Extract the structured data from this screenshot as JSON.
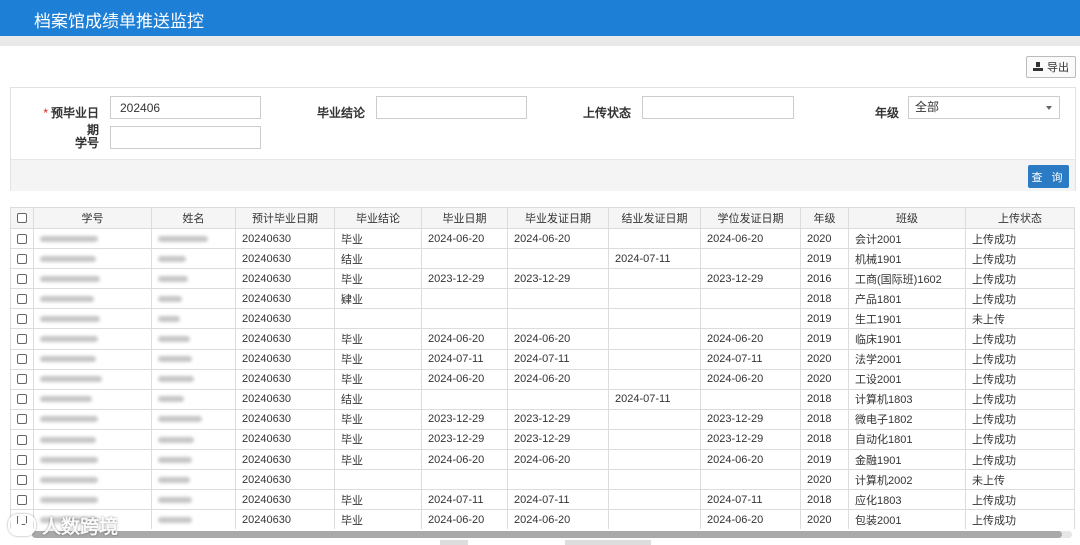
{
  "header": {
    "title": "档案馆成绩单推送监控"
  },
  "toolbar": {
    "export_label": "导出"
  },
  "search": {
    "grad_date_label": "预毕业日期",
    "grad_date_value": "202406",
    "conclusion_label": "毕业结论",
    "conclusion_value": "",
    "upload_status_label": "上传状态",
    "upload_status_value": "",
    "grade_label": "年级",
    "grade_value": "全部",
    "student_id_label": "学号",
    "student_id_value": "",
    "query_label": "查 询"
  },
  "table": {
    "columns": [
      "学号",
      "姓名",
      "预计毕业日期",
      "毕业结论",
      "毕业日期",
      "毕业发证日期",
      "结业发证日期",
      "学位发证日期",
      "年级",
      "班级",
      "上传状态"
    ],
    "rows": [
      [
        "",
        "",
        "20240630",
        "毕业",
        "2024-06-20",
        "2024-06-20",
        "",
        "2024-06-20",
        "2020",
        "会计2001",
        "上传成功"
      ],
      [
        "",
        "",
        "20240630",
        "结业",
        "",
        "",
        "2024-07-11",
        "",
        "2019",
        "机械1901",
        "上传成功"
      ],
      [
        "",
        "",
        "20240630",
        "毕业",
        "2023-12-29",
        "2023-12-29",
        "",
        "2023-12-29",
        "2016",
        "工商(国际班)1602",
        "上传成功"
      ],
      [
        "",
        "",
        "20240630",
        "肄业",
        "",
        "",
        "",
        "",
        "2018",
        "产品1801",
        "上传成功"
      ],
      [
        "",
        "",
        "20240630",
        "",
        "",
        "",
        "",
        "",
        "2019",
        "生工1901",
        "未上传"
      ],
      [
        "",
        "",
        "20240630",
        "毕业",
        "2024-06-20",
        "2024-06-20",
        "",
        "2024-06-20",
        "2019",
        "临床1901",
        "上传成功"
      ],
      [
        "",
        "",
        "20240630",
        "毕业",
        "2024-07-11",
        "2024-07-11",
        "",
        "2024-07-11",
        "2020",
        "法学2001",
        "上传成功"
      ],
      [
        "",
        "",
        "20240630",
        "毕业",
        "2024-06-20",
        "2024-06-20",
        "",
        "2024-06-20",
        "2020",
        "工设2001",
        "上传成功"
      ],
      [
        "",
        "",
        "20240630",
        "结业",
        "",
        "",
        "2024-07-11",
        "",
        "2018",
        "计算机1803",
        "上传成功"
      ],
      [
        "",
        "",
        "20240630",
        "毕业",
        "2023-12-29",
        "2023-12-29",
        "",
        "2023-12-29",
        "2018",
        "微电子1802",
        "上传成功"
      ],
      [
        "",
        "",
        "20240630",
        "毕业",
        "2023-12-29",
        "2023-12-29",
        "",
        "2023-12-29",
        "2018",
        "自动化1801",
        "上传成功"
      ],
      [
        "",
        "",
        "20240630",
        "毕业",
        "2024-06-20",
        "2024-06-20",
        "",
        "2024-06-20",
        "2019",
        "金融1901",
        "上传成功"
      ],
      [
        "",
        "",
        "20240630",
        "",
        "",
        "",
        "",
        "",
        "2020",
        "计算机2002",
        "未上传"
      ],
      [
        "",
        "",
        "20240630",
        "毕业",
        "2024-07-11",
        "2024-07-11",
        "",
        "2024-07-11",
        "2018",
        "应化1803",
        "上传成功"
      ],
      [
        "",
        "",
        "20240630",
        "毕业",
        "2024-06-20",
        "2024-06-20",
        "",
        "2024-06-20",
        "2020",
        "包装2001",
        "上传成功"
      ]
    ]
  },
  "watermark": {
    "text": "人数跨境"
  },
  "icons": {
    "export": "export-icon",
    "checkbox": "checkbox-icon",
    "dropdown": "chevron-down-icon"
  }
}
